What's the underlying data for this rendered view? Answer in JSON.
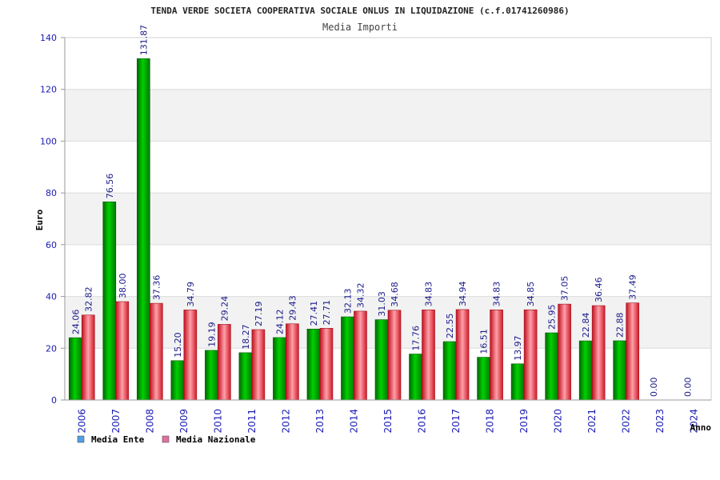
{
  "chart_data": {
    "type": "bar",
    "title": "TENDA VERDE SOCIETA COOPERATIVA SOCIALE ONLUS IN LIQUIDAZIONE (c.f.01741260986)",
    "subtitle": "Media Importi",
    "ylabel": "Euro",
    "xlabel": "Anno",
    "ylim": [
      0,
      140
    ],
    "yticks": [
      0,
      20,
      40,
      60,
      80,
      100,
      120,
      140
    ],
    "grid": "horizontal bands",
    "legend_position": "bottom-left",
    "categories": [
      "2006",
      "2007",
      "2008",
      "2009",
      "2010",
      "2011",
      "2012",
      "2013",
      "2014",
      "2015",
      "2016",
      "2017",
      "2018",
      "2019",
      "2020",
      "2021",
      "2022",
      "2023",
      "2024"
    ],
    "series": [
      {
        "name": "Media Ente",
        "color": "#00b000",
        "legend_color": "#4f9fe8",
        "values": [
          24.06,
          76.56,
          131.87,
          15.2,
          19.19,
          18.27,
          24.12,
          27.41,
          32.13,
          31.03,
          17.76,
          22.55,
          16.51,
          13.97,
          25.95,
          22.84,
          22.88,
          0.0,
          0.0
        ],
        "labels": [
          "24.06",
          "76.56",
          "131.87",
          "15.20",
          "19.19",
          "18.27",
          "24.12",
          "27.41",
          "32.13",
          "31.03",
          "17.76",
          "22.55",
          "16.51",
          "13.97",
          "25.95",
          "22.84",
          "22.88",
          "0.00",
          "0.00"
        ]
      },
      {
        "name": "Media Nazionale",
        "color": "#e83040",
        "legend_color": "#e070a0",
        "values": [
          32.82,
          38.0,
          37.36,
          34.79,
          29.24,
          27.19,
          29.43,
          27.71,
          34.32,
          34.68,
          34.83,
          34.94,
          34.83,
          34.85,
          37.05,
          36.46,
          37.49,
          null,
          null
        ],
        "labels": [
          "32.82",
          "38.00",
          "37.36",
          "34.79",
          "29.24",
          "27.19",
          "29.43",
          "27.71",
          "34.32",
          "34.68",
          "34.83",
          "34.94",
          "34.83",
          "34.85",
          "37.05",
          "36.46",
          "37.49",
          "",
          ""
        ]
      }
    ]
  }
}
